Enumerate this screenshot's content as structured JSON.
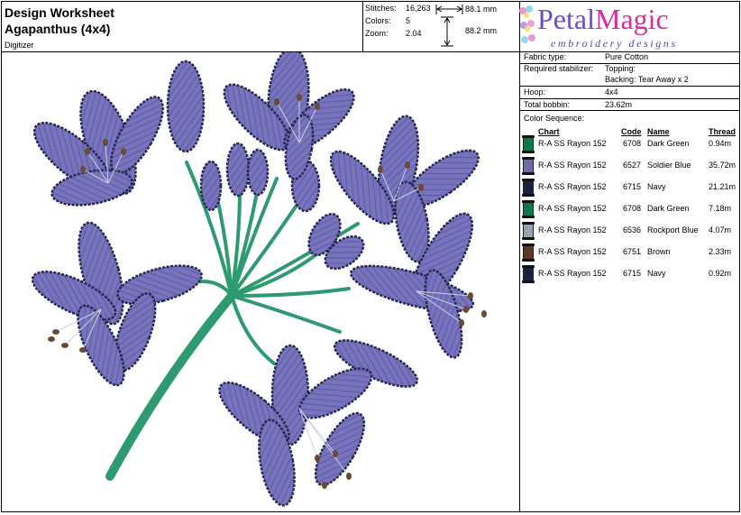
{
  "header": {
    "title": "Design Worksheet",
    "design_name": "Agapanthus (4x4)",
    "digitizer_label": "Digitizer"
  },
  "stats": {
    "stitches_label": "Stitches:",
    "stitches_value": "16,263",
    "colors_label": "Colors:",
    "colors_value": "5",
    "zoom_label": "Zoom:",
    "zoom_value": "2.04",
    "width": "88.1 mm",
    "height": "88.2 mm"
  },
  "logo": {
    "word_petal": "Petal",
    "word_magic": "Magic",
    "tagline": "embroidery designs"
  },
  "details": {
    "fabric_label": "Fabric type:",
    "fabric_value": "Pure Cotton",
    "stabilizer_label": "Required stabilizer:",
    "topping": "Topping:",
    "backing": "Backing: Tear Away x 2",
    "hoop_label": "Hoop:",
    "hoop_value": "4x4",
    "bobbin_label": "Total bobbin:",
    "bobbin_value": "23.62m"
  },
  "color_sequence": {
    "heading": "Color Sequence:",
    "columns": {
      "chart": "Chart",
      "code": "Code",
      "name": "Name",
      "thread": "Thread"
    },
    "rows": [
      {
        "chart": "R-A SS Rayon 152",
        "code": "6708",
        "name": "Dark Green",
        "thread": "0.94m",
        "color": "#0a7a4a"
      },
      {
        "chart": "R-A SS Rayon 152",
        "code": "6527",
        "name": "Soldier Blue",
        "thread": "35.72m",
        "color": "#6f6aa9"
      },
      {
        "chart": "R-A SS Rayon 152",
        "code": "6715",
        "name": "Navy",
        "thread": "21.21m",
        "color": "#1b2140"
      },
      {
        "chart": "R-A SS Rayon 152",
        "code": "6708",
        "name": "Dark Green",
        "thread": "7.18m",
        "color": "#0a7a4a"
      },
      {
        "chart": "R-A SS Rayon 152",
        "code": "6536",
        "name": "Rockport Blue",
        "thread": "4.07m",
        "color": "#9aa4b1"
      },
      {
        "chart": "R-A SS Rayon 152",
        "code": "6751",
        "name": "Brown",
        "thread": "2.33m",
        "color": "#5a3a26"
      },
      {
        "chart": "R-A SS Rayon 152",
        "code": "6715",
        "name": "Navy",
        "thread": "0.92m",
        "color": "#1b2140"
      }
    ]
  },
  "colors": {
    "petal": "#7a78bf",
    "petal_outline": "#2b2a55",
    "stem": "#2d9a6f",
    "stamen": "#6b4a33"
  }
}
